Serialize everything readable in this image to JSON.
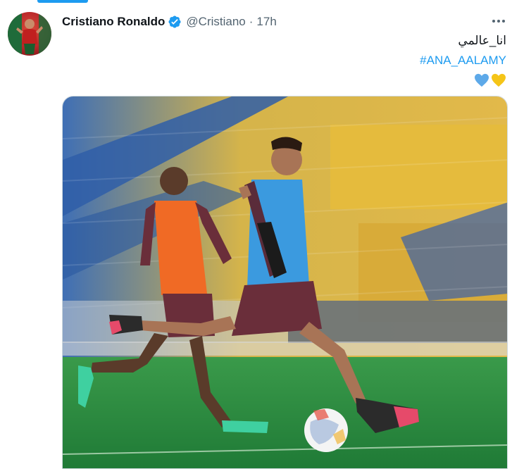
{
  "tweet": {
    "author_name": "Cristiano Ronaldo",
    "handle": "@Cristiano",
    "separator": "·",
    "timestamp": "17h",
    "text_arabic": "انا_عالمي",
    "hashtag": "#ANA_AALAMY",
    "emojis": [
      "blue-heart",
      "yellow-heart"
    ],
    "more_icon": "more-horizontal-icon",
    "verified_icon": "verified-badge-icon"
  },
  "colors": {
    "accent": "#1d9bf0",
    "text_primary": "#0f1419",
    "text_secondary": "#536471",
    "blue_heart": "#5da9e9",
    "yellow_heart": "#f5c518"
  }
}
